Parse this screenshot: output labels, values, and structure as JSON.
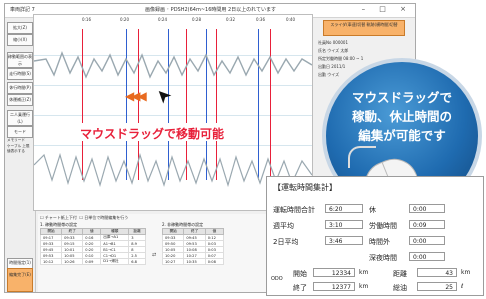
{
  "window": {
    "app_label": "車両詳記 7",
    "title": "画像録画 ･ PDSH2(64m~16時間用 2日以上のれています",
    "controls": "– □ ×"
  },
  "left_panel": {
    "buttons": [
      "拡大(Z)",
      "縮小(X)",
      "稼動範囲の表示",
      "走行時間(S)",
      "休行時間(P)",
      "休運補正(Z)",
      "二人乗運行(L)",
      "モード",
      "時間指定(1)",
      "編集完了(E)"
    ],
    "checkboxes": [
      "メモリード",
      "ケーブル 上限値表示する"
    ]
  },
  "chart": {
    "time_ticks": [
      "0:16",
      "0:20",
      "0:24",
      "0:28",
      "0:32",
      "0:36",
      "0:40"
    ],
    "arrows": "◀◀◀",
    "cursor": "➤",
    "caption": "マウスドラッグで移動可能",
    "line_colors": {
      "red": "#e8203a",
      "blue": "#2f5fd0",
      "trace": "#9aa8b0"
    }
  },
  "right_panel": {
    "orange_button": "スライダ(車速)切替 軌跡(横時間)切替",
    "rows": [
      {
        "label": "社員No",
        "value": "000001"
      },
      {
        "label": "氏名",
        "value": "ウイズ 太郎"
      },
      {
        "label": "所定労働時間",
        "value": "08:00 ~ 1"
      },
      {
        "label": "出勤日",
        "value": "2011/1"
      },
      {
        "label": "出勤",
        "value": "ウイズ"
      }
    ]
  },
  "bottom": {
    "checkbox_labels": [
      "チャート紙上下付",
      "日単位で時間編集を行う"
    ],
    "left_table": {
      "title": "1. 稼動時間帯の設定",
      "headers": [
        "開始",
        "終了",
        "値",
        "種類",
        "距離"
      ],
      "rows": [
        [
          "09:17",
          "09:33",
          "0:16",
          "出庫→A1",
          "3"
        ],
        [
          "09:33",
          "09:15",
          "0:20",
          "A1→B1",
          "8.9"
        ],
        [
          "09:45",
          "10:01",
          "0:20",
          "B1→C1",
          "8"
        ],
        [
          "09:53",
          "10:05",
          "0:10",
          "C1→D1",
          "2.5"
        ],
        [
          "10:12",
          "10:26",
          "0:09",
          "D1→帰社",
          "6.8"
        ]
      ]
    },
    "swap_arrows": "⇄",
    "right_table": {
      "title": "2. 非稼動時間帯の設定",
      "headers": [
        "開始",
        "終了",
        "値"
      ],
      "rows": [
        [
          "09:33",
          "09:45",
          "0:12"
        ],
        [
          "09:50",
          "09:53",
          "0:03"
        ],
        [
          "10:05",
          "10:08",
          "0:03"
        ],
        [
          "10:20",
          "10:27",
          "0:07"
        ],
        [
          "10:27",
          "10:35",
          "0:08"
        ]
      ]
    }
  },
  "stats": {
    "heading": "【運転時間集計】",
    "rows": [
      {
        "label": "運転時間合計",
        "value": "6:20"
      },
      {
        "label": "週平均",
        "value": "3:10"
      },
      {
        "label": "2日平均",
        "value": "3:46"
      }
    ],
    "right_rows": [
      {
        "label": "休",
        "value": "0:00"
      },
      {
        "label": "労働時間",
        "value": "0:09"
      },
      {
        "label": "時間外",
        "value": "0:00"
      },
      {
        "label": "深夜時間",
        "value": "0:00"
      }
    ],
    "odo_icon_label": "ODO",
    "start_label": "開始",
    "start_value": "12334",
    "end_label": "終了",
    "end_value": "12377",
    "km_unit": "km",
    "distance_label": "距離",
    "distance_value": "43",
    "fuel_label": "総油",
    "fuel_value": "25",
    "fuel_unit": "ℓ"
  },
  "bubble": {
    "line1": "マウスドラッグで",
    "line2": "稼動、休止時間の",
    "line3": "編集が可能です"
  }
}
